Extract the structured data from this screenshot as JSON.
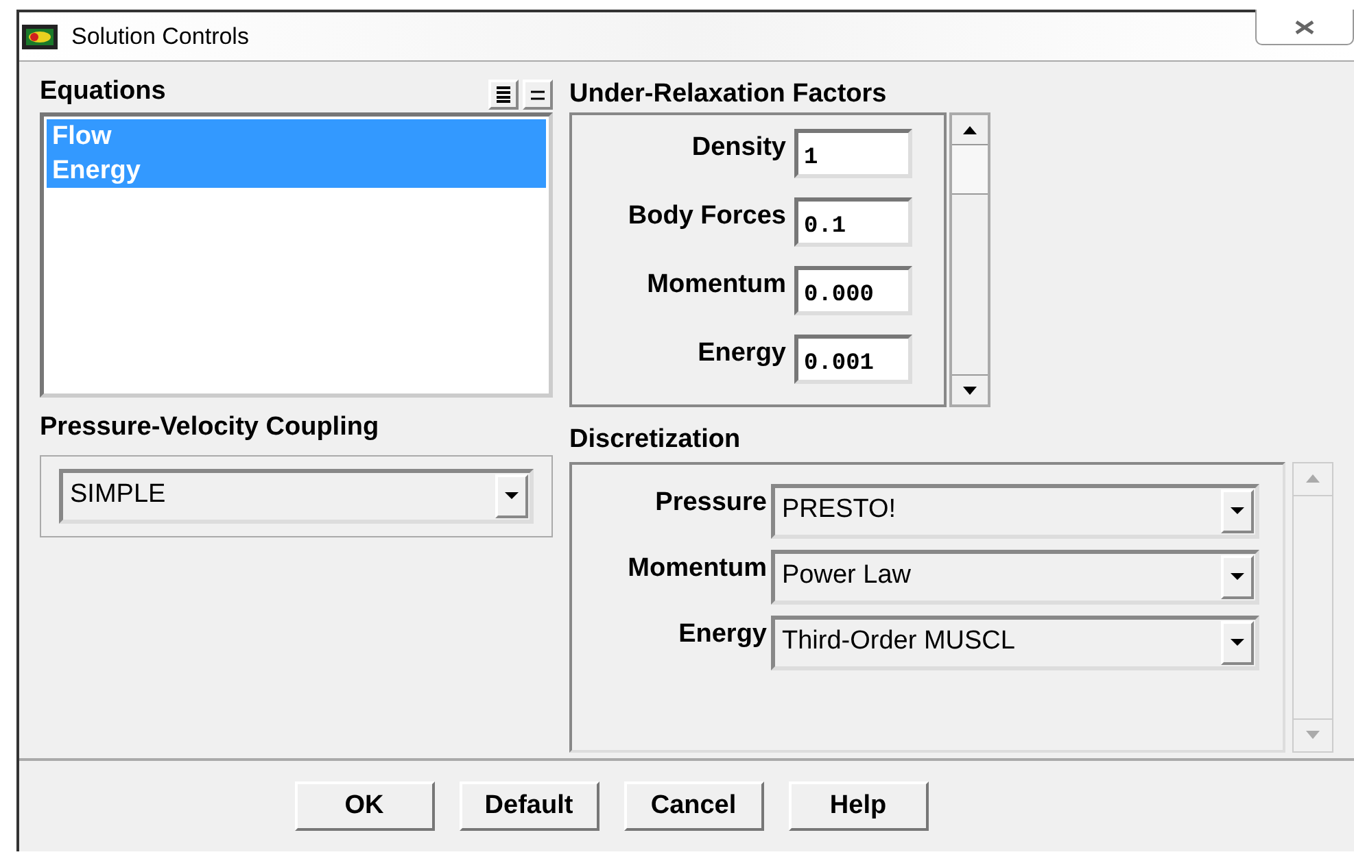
{
  "window": {
    "title": "Solution Controls"
  },
  "equations": {
    "label": "Equations",
    "items": [
      {
        "label": "Flow",
        "selected": true
      },
      {
        "label": "Energy",
        "selected": true
      }
    ]
  },
  "pressure_velocity_coupling": {
    "label": "Pressure-Velocity Coupling",
    "value": "SIMPLE"
  },
  "under_relaxation_factors": {
    "label": "Under-Relaxation Factors",
    "fields": [
      {
        "label": "Density",
        "value": "1"
      },
      {
        "label": "Body Forces",
        "value": "0.1"
      },
      {
        "label": "Momentum",
        "value": "0.000"
      },
      {
        "label": "Energy",
        "value": "0.001"
      }
    ]
  },
  "discretization": {
    "label": "Discretization",
    "rows": [
      {
        "label": "Pressure",
        "value": "PRESTO!"
      },
      {
        "label": "Momentum",
        "value": "Power Law"
      },
      {
        "label": "Energy",
        "value": "Third-Order MUSCL"
      }
    ]
  },
  "buttons": [
    "OK",
    "Default",
    "Cancel",
    "Help"
  ]
}
